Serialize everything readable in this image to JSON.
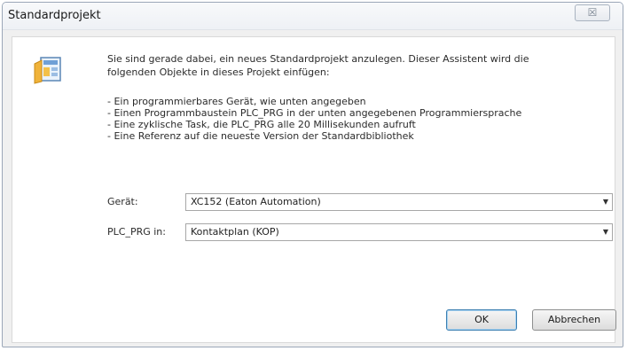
{
  "window": {
    "title": "Standardprojekt",
    "close_symbol": "☒"
  },
  "icon": {
    "name": "wizard-project-icon"
  },
  "intro": {
    "line1": "Sie sind gerade dabei, ein neues Standardprojekt anzulegen. Dieser Assistent wird die",
    "line2": "folgenden Objekte in dieses Projekt einfügen:"
  },
  "bullets": [
    "- Ein programmierbares Gerät, wie unten angegeben",
    "- Einen Programmbaustein PLC_PRG in der unten angegebenen Programmiersprache",
    "- Eine zyklische Task, die PLC_PRG alle 20 Millisekunden aufruft",
    "- Eine Referenz auf die neueste Version der Standardbibliothek"
  ],
  "form": {
    "device_label": "Gerät:",
    "device_value": "XC152 (Eaton Automation)",
    "plc_label": "PLC_PRG in:",
    "plc_value": "Kontaktplan (KOP)"
  },
  "buttons": {
    "ok": "OK",
    "cancel": "Abbrechen"
  }
}
